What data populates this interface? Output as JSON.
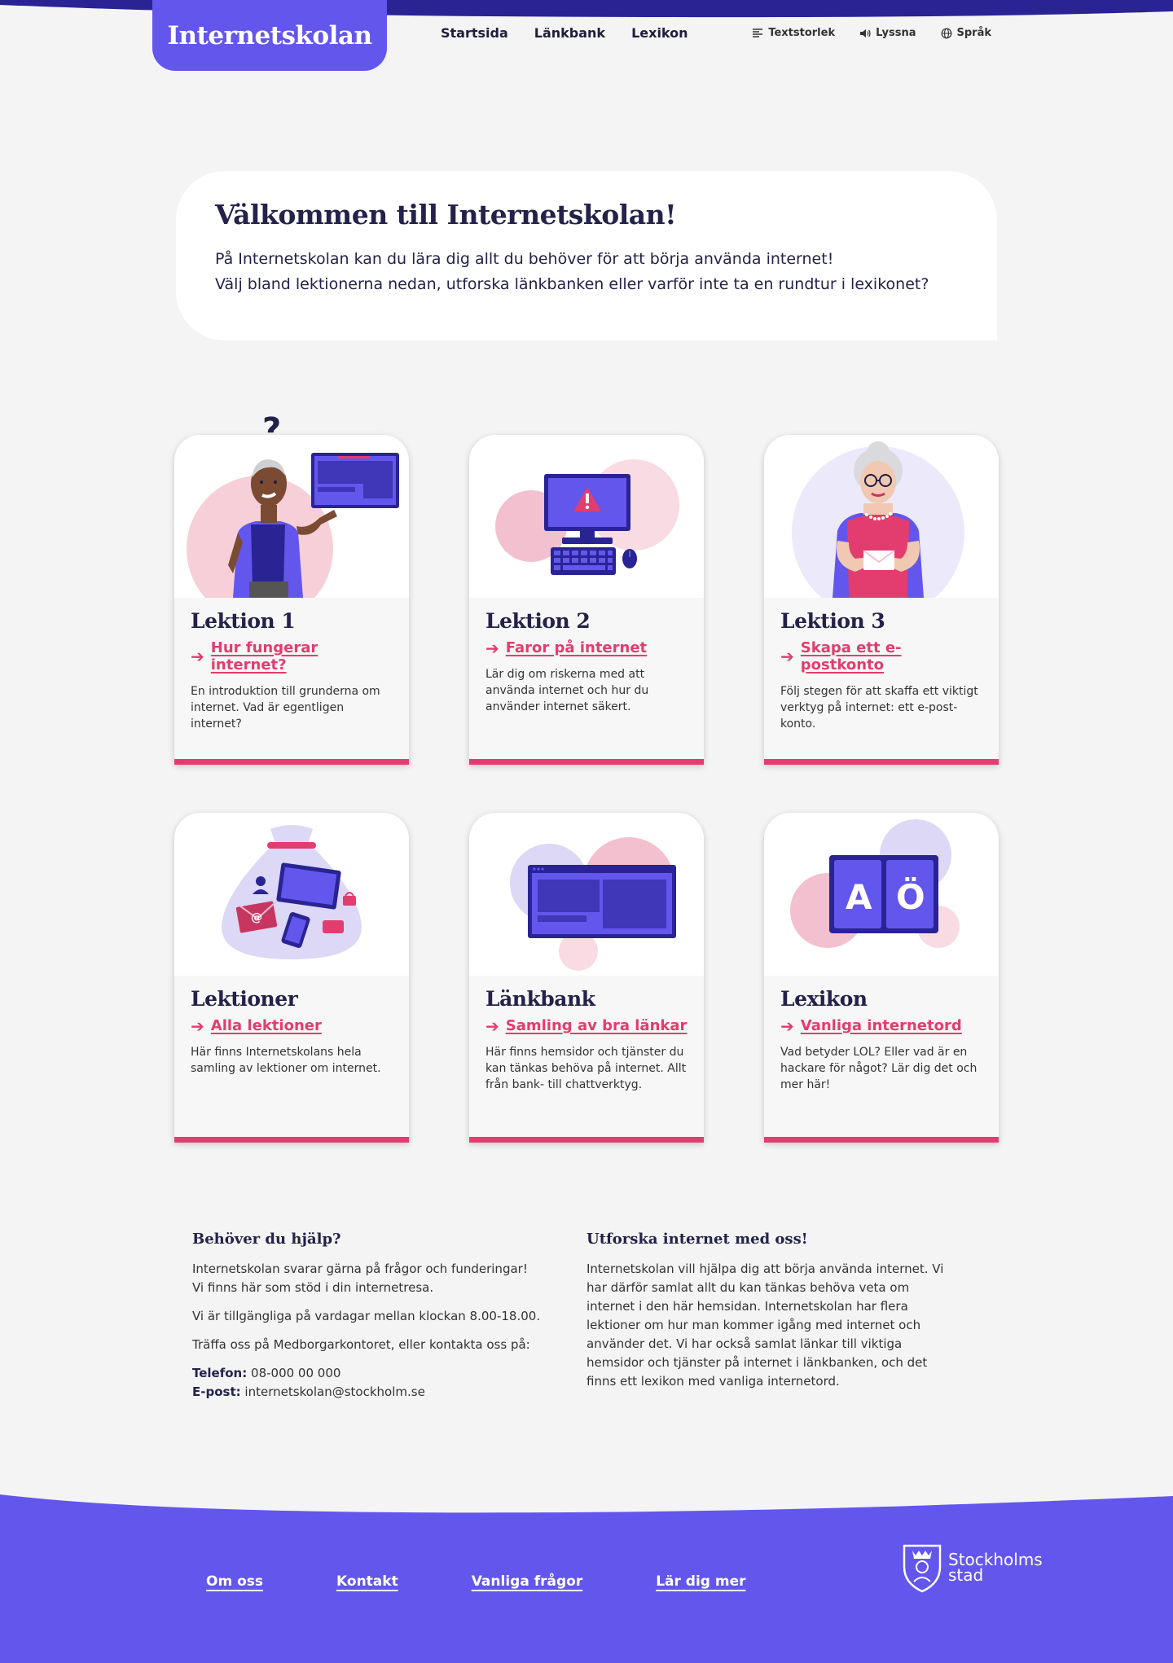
{
  "header": {
    "logo": "Internetskolan",
    "nav": [
      "Startsida",
      "Länkbank",
      "Lexikon"
    ],
    "tools": [
      {
        "label": "Textstorlek",
        "icon": "text-size-icon"
      },
      {
        "label": "Lyssna",
        "icon": "speaker-icon"
      },
      {
        "label": "Språk",
        "icon": "globe-icon"
      }
    ]
  },
  "welcome": {
    "title": "Välkommen till Internetskolan!",
    "line1": "På Internetskolan kan du lära dig allt du behöver för att börja använda internet!",
    "line2": "Välj bland lektionerna nedan, utforska länkbanken eller varför inte ta en rundtur i lexikonet?"
  },
  "cards": [
    {
      "title": "Lektion 1",
      "link": "Hur fungerar internet?",
      "desc": "En introduktion till grunderna om internet. Vad är egentligen internet?"
    },
    {
      "title": "Lektion 2",
      "link": "Faror på internet",
      "desc": "Lär dig om riskerna med att använda internet och hur du använder internet säkert."
    },
    {
      "title": "Lektion 3",
      "link": "Skapa ett e-postkonto",
      "desc": "Följ stegen för att skaffa ett viktigt verktyg på internet: ett e-post-konto."
    },
    {
      "title": "Lektioner",
      "link": "Alla lektioner",
      "desc": "Här finns Internetskolans hela samling av lektioner om internet."
    },
    {
      "title": "Länkbank",
      "link": "Samling av bra länkar",
      "desc": "Här finns hemsidor och tjänster du kan tänkas behöva på internet. Allt från bank- till chattverktyg."
    },
    {
      "title": "Lexikon",
      "link": "Vanliga internetord",
      "desc": "Vad betyder LOL? Eller vad är en hackare för något? Lär dig det och mer här!"
    }
  ],
  "help": {
    "title": "Behöver du hjälp?",
    "p1a": "Internetskolan svarar gärna på frågor och funderingar!",
    "p1b": "Vi finns här som stöd i din internetresa.",
    "p2": "Vi är tillgängliga på vardagar mellan klockan 8.00-18.00.",
    "p3": "Träffa oss på Medborgarkontoret, eller kontakta oss på:",
    "phone_label": "Telefon:",
    "phone": "08-000 00 000",
    "email_label": "E-post:",
    "email": "internetskolan@stockholm.se"
  },
  "explore": {
    "title": "Utforska internet med oss!",
    "text": "Internetskolan vill hjälpa dig att börja använda internet. Vi har därför samlat allt du kan tänkas behöva veta om internet i den här hemsidan. Internetskolan har flera lektioner om hur man kommer igång med internet och använder det. Vi har också samlat länkar till viktiga hemsidor och tjänster på internet i länkbanken, och det finns ett lexikon med vanliga internetord."
  },
  "footer": {
    "links": [
      "Om oss",
      "Kontakt",
      "Vanliga frågor",
      "Lär dig mer"
    ],
    "logo_line1": "Stockholms",
    "logo_line2": "stad"
  },
  "colors": {
    "primary": "#6356ec",
    "accent": "#e23d6e",
    "dark": "#24224a"
  }
}
